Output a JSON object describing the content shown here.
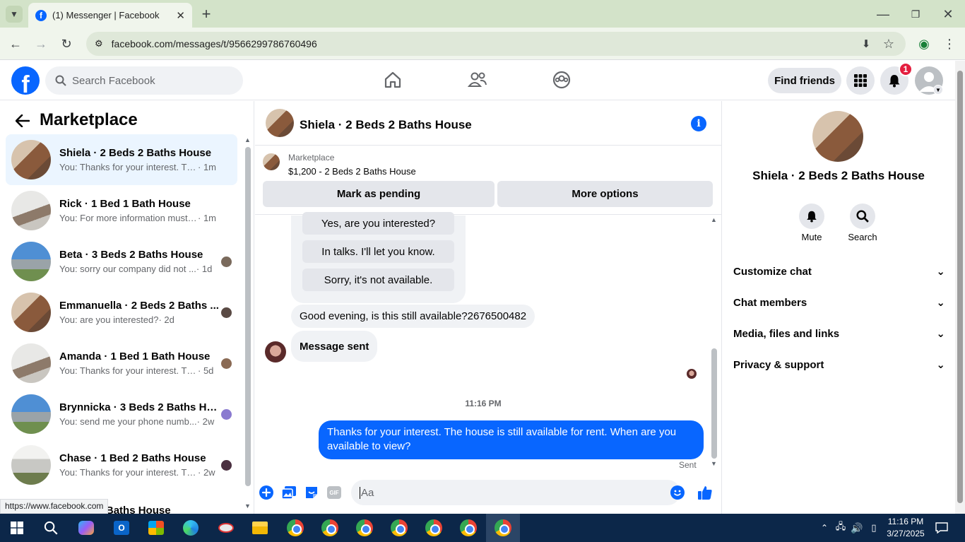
{
  "browser": {
    "tab_title": "(1) Messenger | Facebook",
    "url": "facebook.com/messages/t/9566299786760496",
    "status_link": "https://www.facebook.com"
  },
  "fb_header": {
    "search_placeholder": "Search Facebook",
    "find_friends": "Find friends",
    "notification_count": "1"
  },
  "left_panel": {
    "title": "Marketplace",
    "conversations": [
      {
        "name": "Shiela · 2 Beds 2 Baths House",
        "preview": "You: Thanks for your interest. The ...",
        "time": "· 1m",
        "active": true
      },
      {
        "name": "Rick · 1 Bed 1 Bath House",
        "preview": "You: For more information must se...",
        "time": "· 1m"
      },
      {
        "name": "Beta · 3 Beds 2 Baths House",
        "preview": "You: sorry our company did not ...",
        "time": "· 1d"
      },
      {
        "name": "Emmanuella · 2 Beds 2 Baths ...",
        "preview": "You: are you interested?",
        "time": "· 2d"
      },
      {
        "name": "Amanda · 1 Bed 1 Bath House",
        "preview": "You: Thanks for your interest. Th...",
        "time": "· 5d"
      },
      {
        "name": "Brynnicka · 3 Beds 2 Baths Ho...",
        "preview": "You: send me your phone numb...",
        "time": "· 2w"
      },
      {
        "name": "Chase · 1 Bed 2 Baths House",
        "preview": "You: Thanks for your interest. Th...",
        "time": "· 2w"
      },
      {
        "name": "...Beds 2 Baths House",
        "preview": "",
        "time": ""
      }
    ]
  },
  "chat": {
    "title": "Shiela · 2 Beds 2 Baths House",
    "marketplace_label": "Marketplace",
    "listing": "$1,200 - 2 Beds 2 Baths House",
    "mark_pending": "Mark as pending",
    "more_options": "More options",
    "quick_replies": [
      "Yes, are you interested?",
      "In talks. I'll let you know.",
      "Sorry, it's not available."
    ],
    "incoming_1": "Good evening, is this still available?2676500482",
    "incoming_2": "Message sent",
    "timestamp": "11:16 PM",
    "outgoing": "Thanks for your interest. The house is still available for rent. When are you available to view?",
    "sent_label": "Sent",
    "composer_placeholder": "Aa"
  },
  "right_panel": {
    "name": "Shiela · 2 Beds 2 Baths House",
    "mute": "Mute",
    "search": "Search",
    "sections": [
      "Customize chat",
      "Chat members",
      "Media, files and links",
      "Privacy & support"
    ]
  },
  "taskbar": {
    "time": "11:16 PM",
    "date": "3/27/2025"
  },
  "colors": {
    "fb_blue": "#0866ff",
    "active_conv": "#ebf5ff",
    "taskbar": "#0c2749"
  }
}
